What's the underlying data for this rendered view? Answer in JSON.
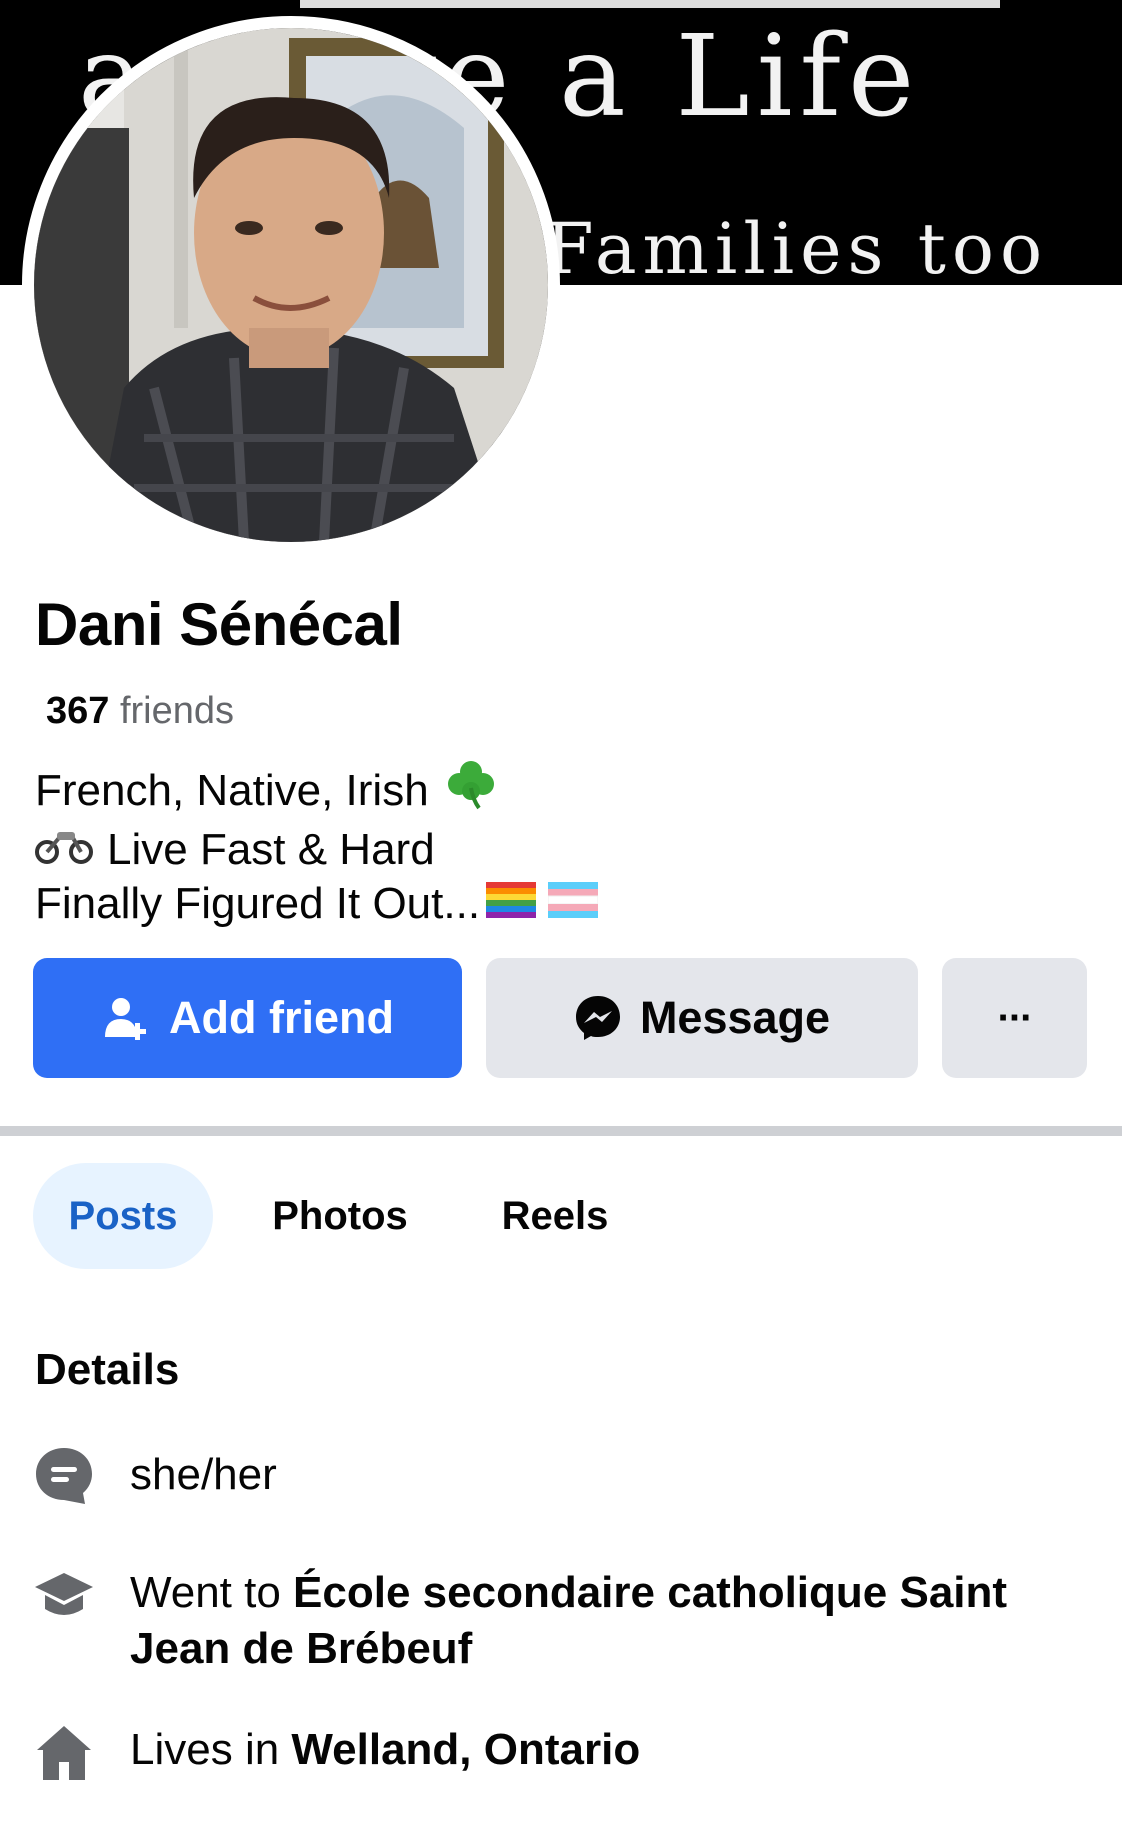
{
  "cover": {
    "line1": "a Have a Life",
    "line2": "Families too"
  },
  "profile": {
    "name": "Dani Sénécal",
    "friends_count": "367",
    "friends_label": "friends",
    "bio": [
      {
        "text": "French, Native, Irish",
        "emoji_after": "shamrock-emoji"
      },
      {
        "text": "Live Fast & Hard",
        "emoji_before": "motorcycle-emoji"
      },
      {
        "text": "Finally Figured It Out...",
        "emoji_after": "pride-and-trans-flag-emoji"
      }
    ]
  },
  "actions": {
    "add_friend": "Add friend",
    "message": "Message",
    "more": "···"
  },
  "tabs": [
    {
      "label": "Posts",
      "active": true
    },
    {
      "label": "Photos",
      "active": false
    },
    {
      "label": "Reels",
      "active": false
    }
  ],
  "details": {
    "title": "Details",
    "pronouns": "she/her",
    "school_prefix": "Went to ",
    "school_name_line1": "École secondaire catholique Saint",
    "school_name_line2": "Jean de Brébeuf",
    "lives_prefix": "Lives in ",
    "lives_place": "Welland, Ontario"
  },
  "colors": {
    "primary": "#2f6ff5",
    "secondary_button": "#e4e6eb",
    "active_tab_bg": "#e7f3ff",
    "active_tab_text": "#1a62c6",
    "muted_text": "#65676b"
  }
}
